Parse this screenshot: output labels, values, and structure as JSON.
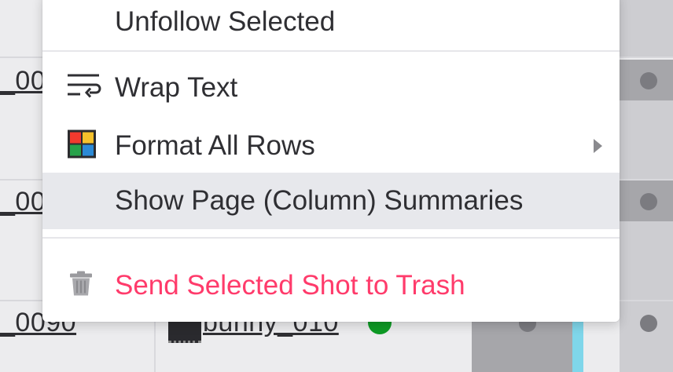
{
  "background_table": {
    "row_cells": [
      "_00",
      "_00",
      "_0090"
    ],
    "bunny_label": "bunny_010"
  },
  "context_menu": {
    "items": [
      {
        "label": "Unfollow Selected",
        "icon": "none"
      },
      {
        "label": "Wrap Text",
        "icon": "wrap-text-icon"
      },
      {
        "label": "Format All Rows",
        "icon": "color-grid-icon",
        "has_submenu": true
      },
      {
        "label": "Show Page (Column) Summaries",
        "icon": "none",
        "highlighted": true
      },
      {
        "label": "Send Selected Shot to Trash",
        "icon": "trash-icon",
        "danger": true
      }
    ]
  },
  "colors": {
    "danger": "#ff3b6b",
    "highlight": "#e7e8ec",
    "status_green": "#0e9b25",
    "accent_cyan": "#7fd6ea"
  }
}
